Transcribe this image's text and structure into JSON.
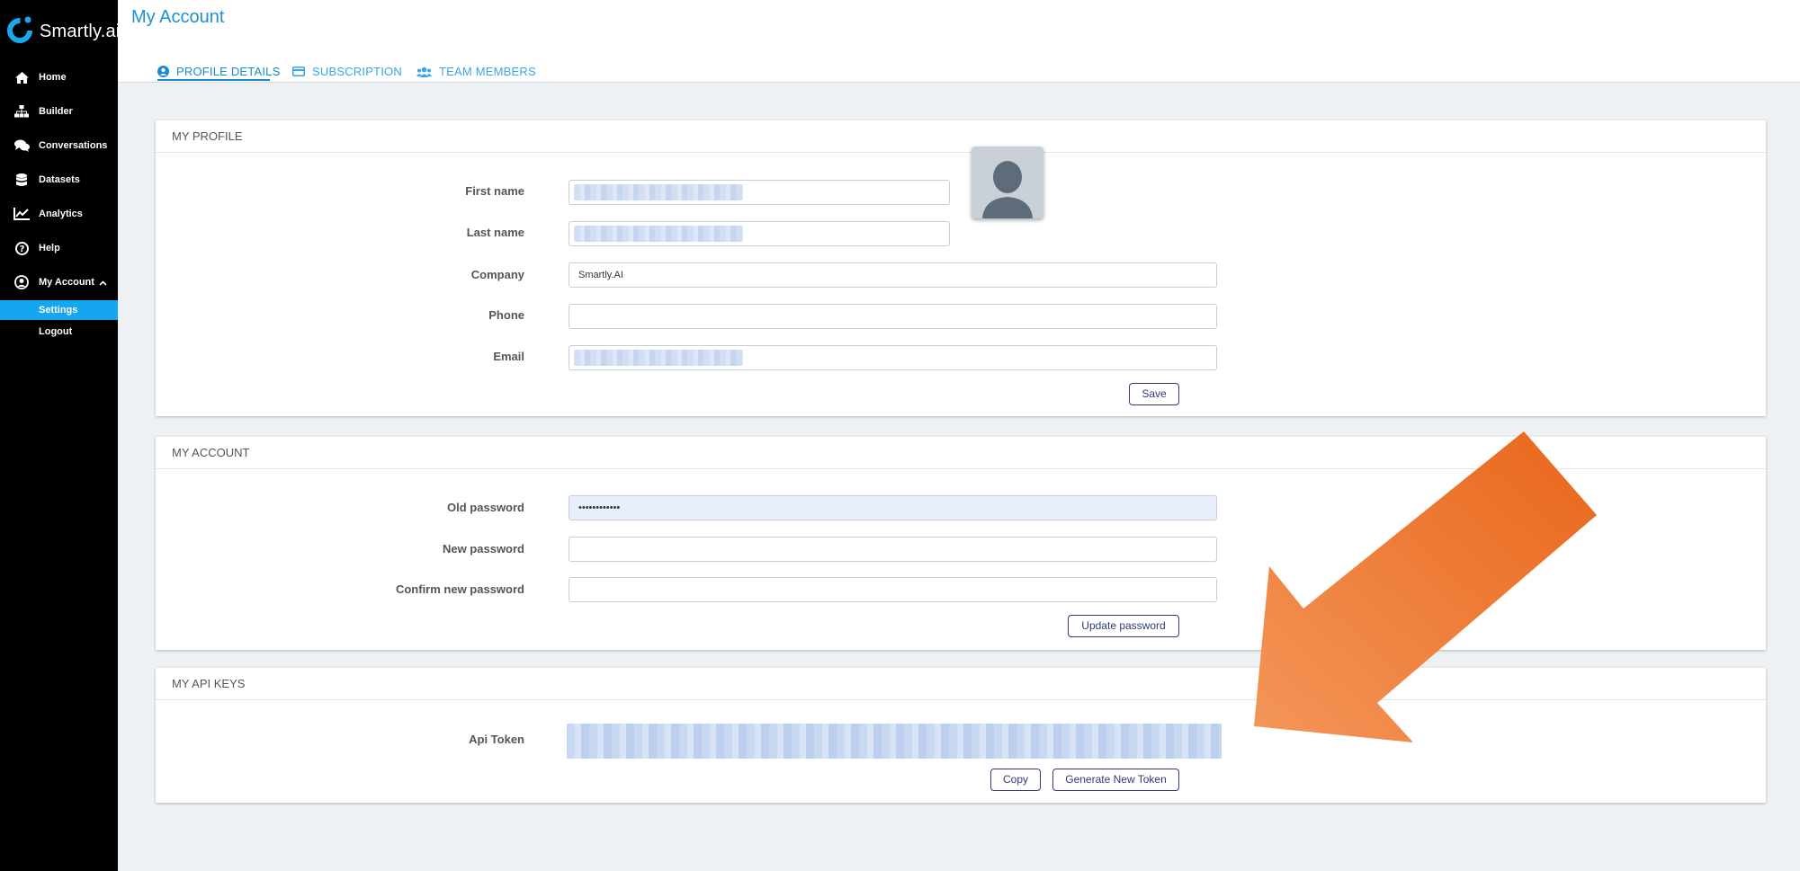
{
  "app": {
    "brand": "Smartly.ai"
  },
  "sidebar": {
    "items": [
      {
        "label": "Home",
        "icon": "home-icon"
      },
      {
        "label": "Builder",
        "icon": "sitemap-icon"
      },
      {
        "label": "Conversations",
        "icon": "comments-icon"
      },
      {
        "label": "Datasets",
        "icon": "database-icon"
      },
      {
        "label": "Analytics",
        "icon": "chart-line-icon"
      },
      {
        "label": "Help",
        "icon": "question-circle-icon"
      },
      {
        "label": "My Account",
        "icon": "user-circle-icon"
      }
    ],
    "sub_items": [
      {
        "label": "Settings",
        "active": true
      },
      {
        "label": "Logout",
        "active": false
      }
    ]
  },
  "header": {
    "title": "My Account",
    "tabs": [
      {
        "label": "PROFILE DETAILS",
        "active": true,
        "icon": "user-circle-icon"
      },
      {
        "label": "SUBSCRIPTION",
        "active": false,
        "icon": "credit-card-icon"
      },
      {
        "label": "TEAM MEMBERS",
        "active": false,
        "icon": "users-icon"
      }
    ]
  },
  "profile": {
    "title": "MY PROFILE",
    "first_name_label": "First name",
    "last_name_label": "Last name",
    "company_label": "Company",
    "company_value": "Smartly.AI",
    "phone_label": "Phone",
    "phone_value": "",
    "email_label": "Email",
    "save_label": "Save"
  },
  "account": {
    "title": "MY ACCOUNT",
    "old_password_label": "Old password",
    "old_password_value": "••••••••••••",
    "new_password_label": "New password",
    "confirm_password_label": "Confirm new password",
    "update_label": "Update password"
  },
  "api_keys": {
    "title": "MY API KEYS",
    "token_label": "Api Token",
    "copy_label": "Copy",
    "generate_label": "Generate New Token"
  },
  "colors": {
    "accent": "#1a8ad0",
    "sidebar_active": "#14a6ef",
    "button_border": "#2f3a7a",
    "arrow": "#ee7a30"
  }
}
